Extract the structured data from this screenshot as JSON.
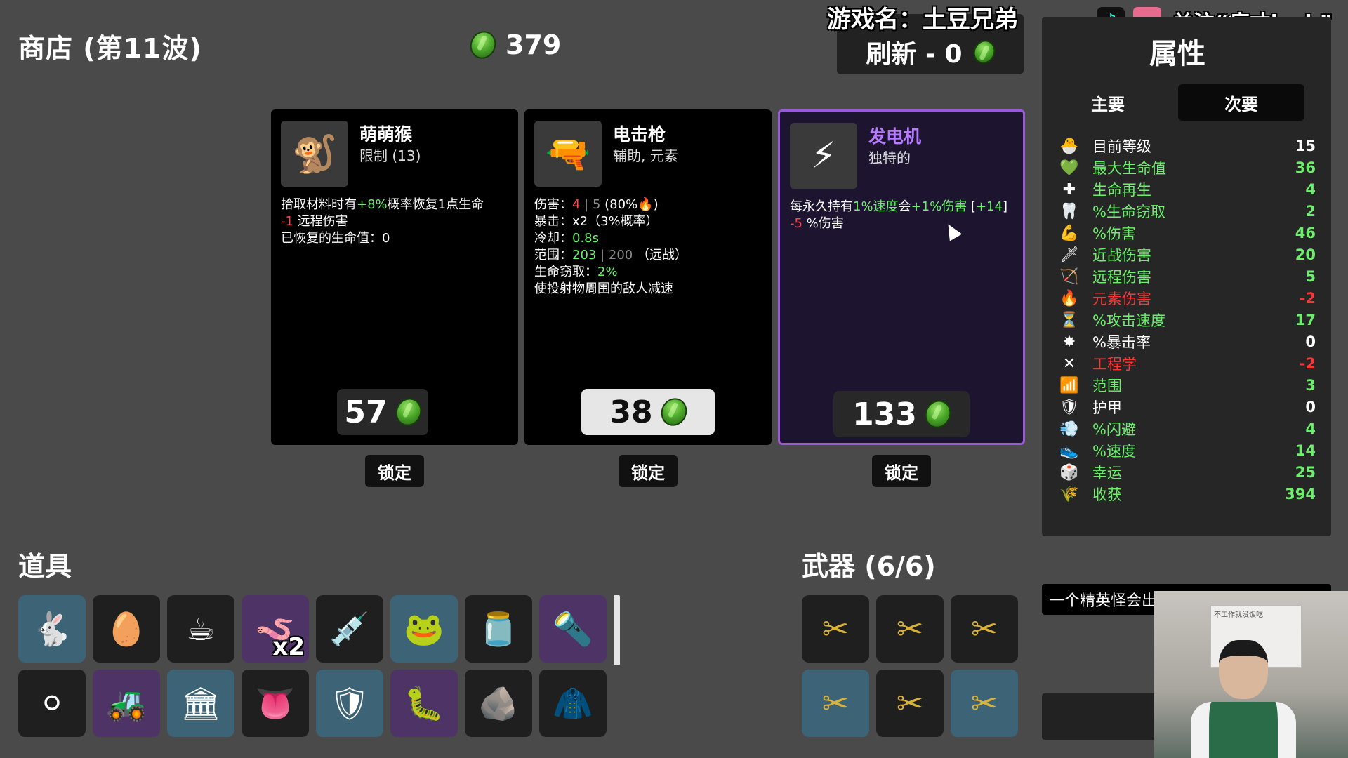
{
  "shop": {
    "title": "商店 (第11波)",
    "gold": "379"
  },
  "overlay": {
    "game_name": "游戏名：土豆兄弟",
    "follow": "关注“疯才lock”",
    "tiktok_glyph": "♪",
    "bili_glyph": "bilibili"
  },
  "reroll": {
    "label": "刷新 - 0"
  },
  "cards": [
    {
      "name": "萌萌猴",
      "subtitle": "限制 (13)",
      "icon": "monkey-icon",
      "desc": [
        [
          {
            "t": "拾取材料时有",
            "c": ""
          },
          {
            "t": "+8%",
            "c": "g"
          },
          {
            "t": "概率恢复1点生命",
            "c": ""
          }
        ],
        [
          {
            "t": "-1",
            "c": "r"
          },
          {
            "t": " 远程伤害",
            "c": ""
          }
        ],
        [
          {
            "t": "已恢复的生命值：0",
            "c": ""
          }
        ]
      ],
      "price": "57",
      "lock": "锁定",
      "price_style": "dark"
    },
    {
      "name": "电击枪",
      "subtitle": "辅助, 元素",
      "icon": "taser-icon",
      "desc": [
        [
          {
            "t": "伤害：",
            "c": ""
          },
          {
            "t": "4",
            "c": "r"
          },
          {
            "t": " | 5 ",
            "c": "d"
          },
          {
            "t": "(80%🔥)",
            "c": ""
          }
        ],
        [
          {
            "t": "暴击：x2（3%概率）",
            "c": ""
          }
        ],
        [
          {
            "t": "冷却：",
            "c": ""
          },
          {
            "t": "0.8s",
            "c": "g"
          }
        ],
        [
          {
            "t": "范围：",
            "c": ""
          },
          {
            "t": "203",
            "c": "g"
          },
          {
            "t": " | 200 ",
            "c": "d"
          },
          {
            "t": "（远战）",
            "c": ""
          }
        ],
        [
          {
            "t": "生命窃取：",
            "c": ""
          },
          {
            "t": "2%",
            "c": "g"
          }
        ],
        [
          {
            "t": "使投射物周围的敌人减速",
            "c": ""
          }
        ]
      ],
      "price": "38",
      "lock": "锁定",
      "price_style": "light"
    },
    {
      "name": "发电机",
      "subtitle": "独特的",
      "icon": "generator-icon",
      "desc": [
        [
          {
            "t": "每永久持有",
            "c": ""
          },
          {
            "t": "1%速度",
            "c": "g"
          },
          {
            "t": "会",
            "c": ""
          },
          {
            "t": "+1%伤害",
            "c": "g"
          },
          {
            "t": " [",
            "c": ""
          },
          {
            "t": "+14",
            "c": "g"
          },
          {
            "t": "]",
            "c": ""
          }
        ],
        [
          {
            "t": "-5",
            "c": "r"
          },
          {
            "t": " %伤害",
            "c": ""
          }
        ]
      ],
      "price": "133",
      "lock": "锁定",
      "price_style": "dark"
    }
  ],
  "items": {
    "title": "道具",
    "row1": [
      {
        "glyph": "🐇",
        "style": "blue",
        "name": "rabbit-item-icon"
      },
      {
        "glyph": "🥚",
        "style": "dark",
        "name": "egg-face-item-icon"
      },
      {
        "glyph": "☕",
        "style": "dark",
        "name": "coffee-item-icon"
      },
      {
        "glyph": "🪱",
        "style": "purple",
        "name": "worm-item-icon",
        "badge": "x2"
      },
      {
        "glyph": "💉",
        "style": "dark",
        "name": "syringe-item-icon"
      },
      {
        "glyph": "🐸",
        "style": "blue",
        "name": "frog-item-icon"
      },
      {
        "glyph": "🫙",
        "style": "dark",
        "name": "jar-item-icon"
      },
      {
        "glyph": "🔦",
        "style": "purple",
        "name": "horn-item-icon"
      }
    ],
    "row2": [
      {
        "glyph": "⚪",
        "style": "dark",
        "name": "white-orb-item-icon"
      },
      {
        "glyph": "🚜",
        "style": "purple",
        "name": "tractor-item-icon"
      },
      {
        "glyph": "🏛",
        "style": "blue",
        "name": "tower-item-icon"
      },
      {
        "glyph": "👅",
        "style": "dark",
        "name": "tongue-item-icon"
      },
      {
        "glyph": "🛡",
        "style": "blue",
        "name": "armor-item-icon"
      },
      {
        "glyph": "🐛",
        "style": "purple",
        "name": "tardigrade-item-icon"
      },
      {
        "glyph": "🪨",
        "style": "dark",
        "name": "coal-item-icon"
      },
      {
        "glyph": "🧥",
        "style": "dark",
        "name": "flannel-item-icon"
      }
    ]
  },
  "weapons": {
    "title": "武器 (6/6)",
    "slots": [
      {
        "glyph": "✂",
        "style": "dark"
      },
      {
        "glyph": "✂",
        "style": "dark"
      },
      {
        "glyph": "✂",
        "style": "dark"
      },
      {
        "glyph": "✂",
        "style": "blue"
      },
      {
        "glyph": "✂",
        "style": "dark"
      },
      {
        "glyph": "✂",
        "style": "blue"
      }
    ]
  },
  "stats": {
    "title": "属性",
    "tab_primary": "主要",
    "tab_secondary": "次要",
    "rows": [
      {
        "icon": "🐣",
        "label": "目前等级",
        "value": "15",
        "color": "white"
      },
      {
        "icon": "💚",
        "label": "最大生命值",
        "value": "36",
        "color": "green"
      },
      {
        "icon": "✚",
        "label": "生命再生",
        "value": "4",
        "color": "green"
      },
      {
        "icon": "🦷",
        "label": "%生命窃取",
        "value": "2",
        "color": "green"
      },
      {
        "icon": "💪",
        "label": "%伤害",
        "value": "46",
        "color": "green"
      },
      {
        "icon": "🗡",
        "label": "近战伤害",
        "value": "20",
        "color": "green"
      },
      {
        "icon": "🏹",
        "label": "远程伤害",
        "value": "5",
        "color": "green"
      },
      {
        "icon": "🔥",
        "label": "元素伤害",
        "value": "-2",
        "color": "red"
      },
      {
        "icon": "⏳",
        "label": "%攻击速度",
        "value": "17",
        "color": "green"
      },
      {
        "icon": "✸",
        "label": "%暴击率",
        "value": "0",
        "color": "white"
      },
      {
        "icon": "✕",
        "label": "工程学",
        "value": "-2",
        "color": "red"
      },
      {
        "icon": "📶",
        "label": "范围",
        "value": "3",
        "color": "green"
      },
      {
        "icon": "🛡",
        "label": "护甲",
        "value": "0",
        "color": "white"
      },
      {
        "icon": "💨",
        "label": "%闪避",
        "value": "4",
        "color": "green"
      },
      {
        "icon": "👟",
        "label": "%速度",
        "value": "14",
        "color": "green"
      },
      {
        "icon": "🎲",
        "label": "幸运",
        "value": "25",
        "color": "green"
      },
      {
        "icon": "🌾",
        "label": "收获",
        "value": "394",
        "color": "green"
      }
    ]
  },
  "tooltip": {
    "text": "一个精英怪会出"
  },
  "webcam": {
    "poster_text": "不工作就没饭吃"
  }
}
